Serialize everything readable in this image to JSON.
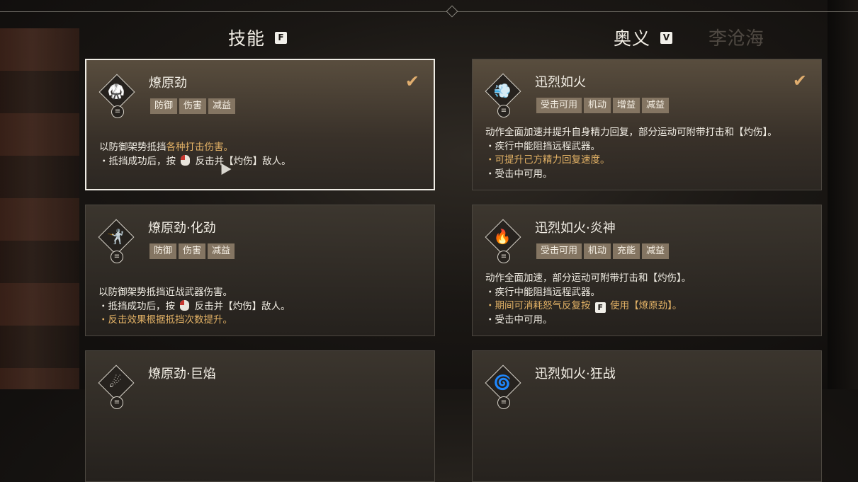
{
  "header": {
    "skills": {
      "title": "技能",
      "key": "F"
    },
    "ultimates": {
      "title": "奥义",
      "key": "V"
    },
    "bg_name": "李沧海"
  },
  "skills": [
    {
      "title": "燎原劲",
      "equipped": true,
      "tags": [
        "防御",
        "伤害",
        "减益"
      ],
      "lines": [
        [
          {
            "t": "以防御架势抵挡"
          },
          {
            "t": "各种打击伤害。",
            "gold": true
          }
        ],
        [
          {
            "t": "・抵挡成功后，按 "
          },
          {
            "icon": "mouse"
          },
          {
            "t": " 反击并【灼伤】敌人。"
          }
        ]
      ]
    },
    {
      "title": "燎原劲·化劲",
      "equipped": false,
      "tags": [
        "防御",
        "伤害",
        "减益"
      ],
      "lines": [
        [
          {
            "t": "以防御架势抵挡近战武器伤害。"
          }
        ],
        [
          {
            "t": "・抵挡成功后，按 "
          },
          {
            "icon": "mouse"
          },
          {
            "t": " 反击并【灼伤】敌人。"
          }
        ],
        [
          {
            "t": "・反击效果根据抵挡次数提升。",
            "gold": true
          }
        ]
      ]
    },
    {
      "title": "燎原劲·巨焰",
      "equipped": false,
      "tags": [],
      "lines": []
    }
  ],
  "ultimates": [
    {
      "title": "迅烈如火",
      "equipped": true,
      "tags": [
        "受击可用",
        "机动",
        "增益",
        "减益"
      ],
      "lines": [
        [
          {
            "t": "动作全面加速并提升自身精力回复，部分运动可附带打击和【灼伤】。"
          }
        ],
        [
          {
            "t": "・疾行中能阻挡远程武器。"
          }
        ],
        [
          {
            "t": "・可提升己方精力回复速度。",
            "gold": true
          }
        ],
        [
          {
            "t": "・受击中可用。"
          }
        ]
      ]
    },
    {
      "title": "迅烈如火·炎神",
      "equipped": false,
      "tags": [
        "受击可用",
        "机动",
        "充能",
        "减益"
      ],
      "lines": [
        [
          {
            "t": "动作全面加速，部分运动可附带打击和【灼伤】。"
          }
        ],
        [
          {
            "t": "・疾行中能阻挡远程武器。"
          }
        ],
        [
          {
            "t": "・期间可消耗怒气反复按 ",
            "gold": true
          },
          {
            "key": "F"
          },
          {
            "t": " 使用【燎原劲】。",
            "gold": true
          }
        ],
        [
          {
            "t": "・受击中可用。"
          }
        ]
      ]
    },
    {
      "title": "迅烈如火·狂战",
      "equipped": false,
      "tags": [],
      "lines": []
    }
  ],
  "icons": {
    "check": "checkmark-icon",
    "menu": "menu-circle-icon",
    "mouse": "mouse-left-click-icon"
  },
  "colors": {
    "accent_gold": "#e3b266",
    "check_color": "#e0ad6e",
    "tag_bg": "#847562"
  }
}
